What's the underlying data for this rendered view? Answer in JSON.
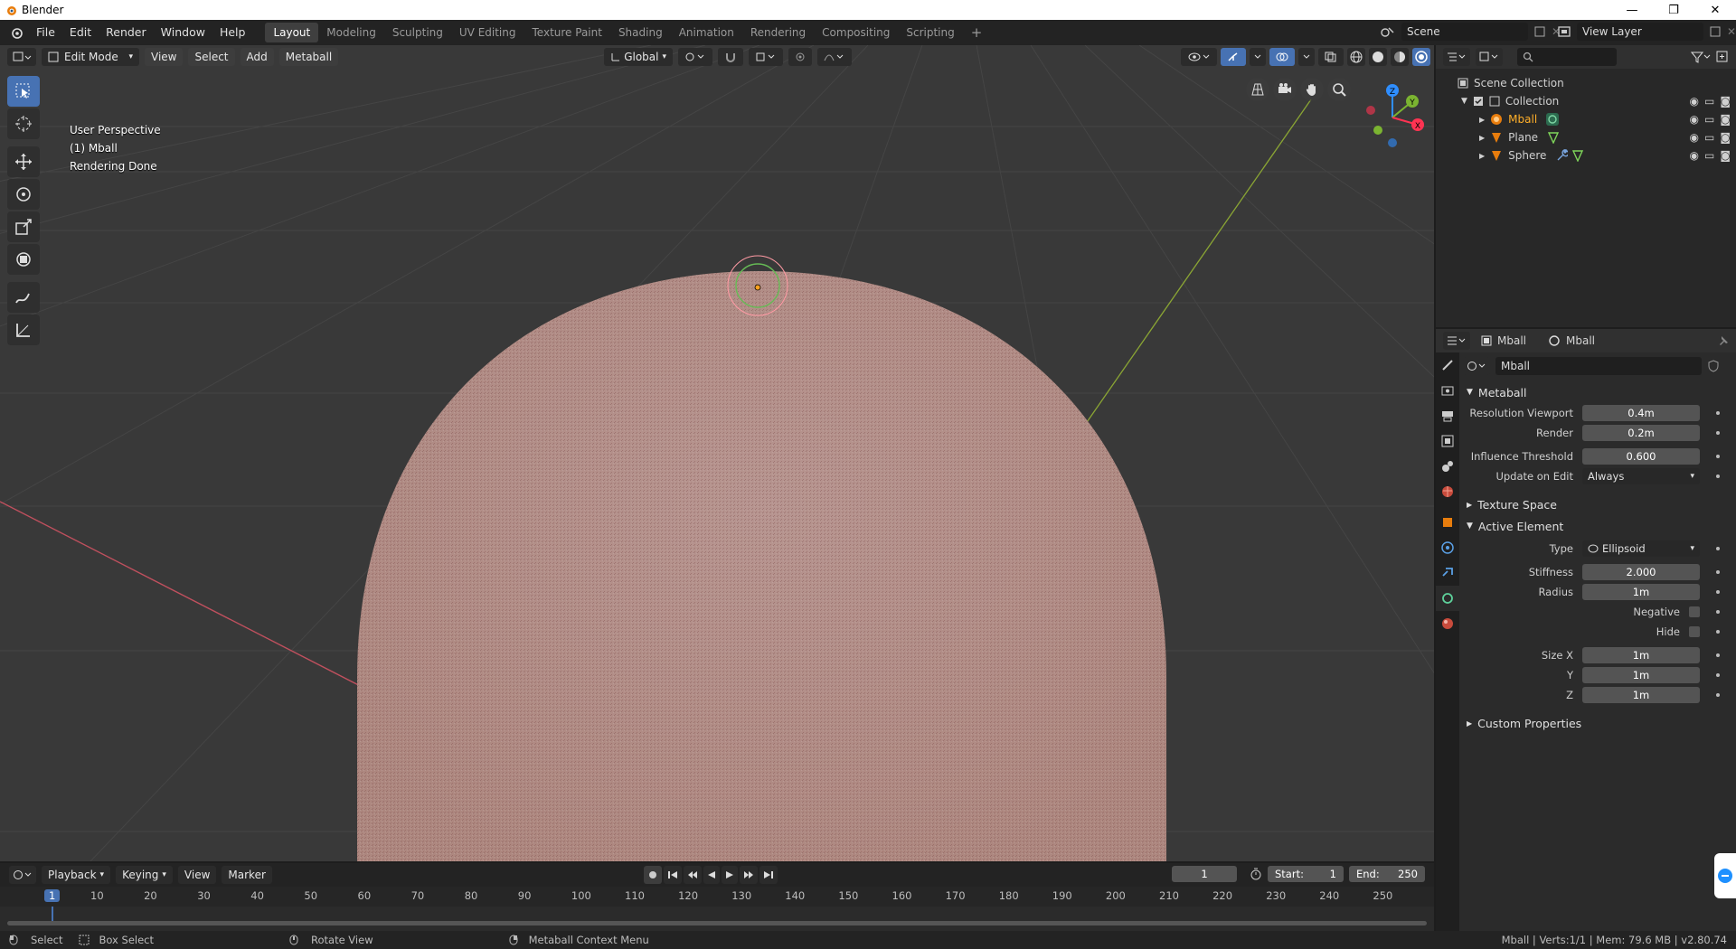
{
  "window": {
    "title": "Blender",
    "controls": [
      "—",
      "❐",
      "✕"
    ]
  },
  "menu": [
    "File",
    "Edit",
    "Render",
    "Window",
    "Help"
  ],
  "workspaces": [
    {
      "label": "Layout",
      "active": true
    },
    {
      "label": "Modeling"
    },
    {
      "label": "Sculpting"
    },
    {
      "label": "UV Editing"
    },
    {
      "label": "Texture Paint"
    },
    {
      "label": "Shading"
    },
    {
      "label": "Animation"
    },
    {
      "label": "Rendering"
    },
    {
      "label": "Compositing"
    },
    {
      "label": "Scripting"
    }
  ],
  "add_workspace": "+",
  "scene": {
    "name": "Scene",
    "view_layer": "View Layer"
  },
  "viewport": {
    "mode": "Edit Mode",
    "menus": [
      "View",
      "Select",
      "Add",
      "Metaball"
    ],
    "transform_orientation": "Global",
    "overlay_lines": [
      "User Perspective",
      "(1) Mball",
      "Rendering Done"
    ],
    "gizmo": {
      "x": "X",
      "y": "Y",
      "z": "Z"
    },
    "colors": {
      "bg": "#393939",
      "grid": "#444444",
      "x_axis": "#c0505e",
      "y_axis": "#8aa534",
      "sphere": "#b58e88"
    }
  },
  "outliner": {
    "root": "Scene Collection",
    "collection": "Collection",
    "items": [
      {
        "name": "Mball",
        "active": true
      },
      {
        "name": "Plane"
      },
      {
        "name": "Sphere"
      }
    ]
  },
  "properties": {
    "object_name": "Mball",
    "data_name": "Mball",
    "datablock": "Mball",
    "sections": {
      "metaball": "Metaball",
      "texture_space": "Texture Space",
      "active_element": "Active Element",
      "custom_properties": "Custom Properties"
    },
    "metaball": {
      "res_viewport_label": "Resolution Viewport",
      "res_viewport": "0.4m",
      "render_label": "Render",
      "render": "0.2m",
      "influence_label": "Influence Threshold",
      "influence": "0.600",
      "update_label": "Update on Edit",
      "update": "Always"
    },
    "element": {
      "type_label": "Type",
      "type": "Ellipsoid",
      "stiffness_label": "Stiffness",
      "stiffness": "2.000",
      "radius_label": "Radius",
      "radius": "1m",
      "negative_label": "Negative",
      "hide_label": "Hide",
      "size_x_label": "Size X",
      "size_x": "1m",
      "y_label": "Y",
      "size_y": "1m",
      "z_label": "Z",
      "size_z": "1m"
    }
  },
  "timeline": {
    "menus": [
      "Playback",
      "Keying",
      "View",
      "Marker"
    ],
    "current_frame": "1",
    "start_label": "Start:",
    "start": "1",
    "end_label": "End:",
    "end": "250",
    "ruler": [
      "1",
      "10",
      "20",
      "30",
      "40",
      "50",
      "60",
      "70",
      "80",
      "90",
      "100",
      "110",
      "120",
      "130",
      "140",
      "150",
      "160",
      "170",
      "180",
      "190",
      "200",
      "210",
      "220",
      "230",
      "240",
      "250"
    ]
  },
  "status": {
    "select": "Select",
    "box_select": "Box Select",
    "rotate_view": "Rotate View",
    "context_menu": "Metaball Context Menu",
    "stats": "Mball | Verts:1/1 | Mem: 79.6 MB | v2.80.74"
  }
}
